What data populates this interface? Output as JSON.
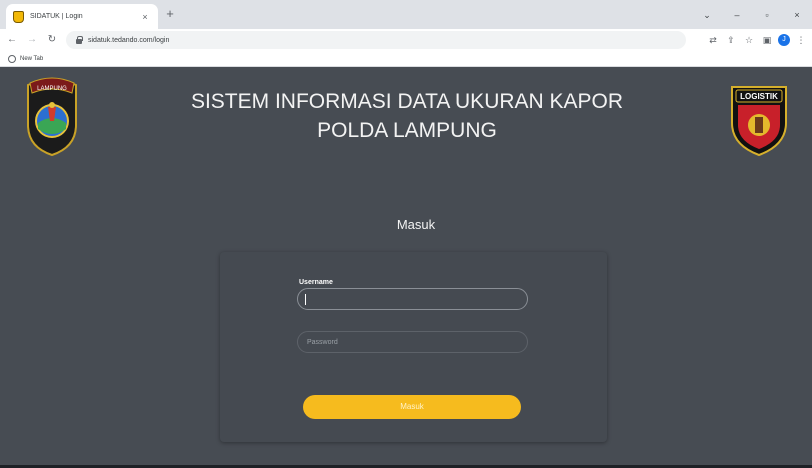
{
  "browser": {
    "tab_title": "SIDATUK | Login",
    "tab_close": "×",
    "new_tab": "+",
    "url": "sidatuk.tedando.com/login",
    "bookmark_label": "New Tab",
    "controls": {
      "collapse": "⌄",
      "minimize": "–",
      "restore": "▫",
      "close": "×"
    },
    "profile_initial": "J"
  },
  "page": {
    "title_line1": "SISTEM INFORMASI DATA UKURAN KAPOR",
    "title_line2": "POLDA LAMPUNG",
    "left_logo_text": "LAMPUNG",
    "right_logo_text": "LOGISTIK",
    "login_heading": "Masuk",
    "username_label": "Username",
    "username_value": "",
    "password_placeholder": "Password",
    "submit_label": "Masuk"
  },
  "colors": {
    "background": "#474c53",
    "accent": "#f6bb1e",
    "text": "#f3f3f3"
  }
}
